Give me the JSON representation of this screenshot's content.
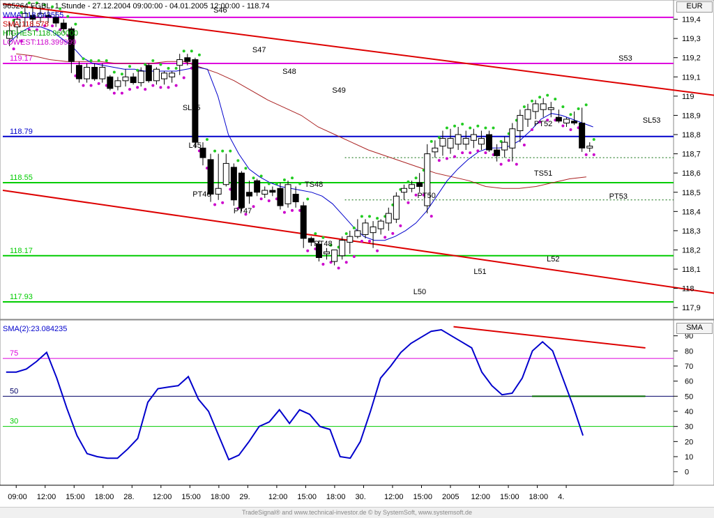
{
  "header": {
    "title": "965264  FGBL, 1 Stunde - 27.12.2004 09:00:00 - 04.01.2005 12:00:00 - 118.74",
    "indicators": [
      {
        "text": "WMA:118.843555",
        "color": "#0000cc"
      },
      {
        "text": "SMA:118.578",
        "color": "#cc0000"
      },
      {
        "text": "HIGHEST:118.960000",
        "color": "#00aa00"
      },
      {
        "text": "LOWEST:118.399999",
        "color": "#cc00cc"
      }
    ],
    "currency": "EUR",
    "lower_label": "SMA(2):23.084235",
    "lower_axis_label": "SMA"
  },
  "footer": "TradeSignal® and www.technical-investor.de © by SystemSoft, www.systemsoft.de",
  "chart_data": [
    {
      "type": "candlestick",
      "ylim": [
        117.85,
        119.5
      ],
      "y_ticks": [
        "119,4",
        "119,3",
        "119,2",
        "119,1",
        "119",
        "118,9",
        "118,8",
        "118,7",
        "118,6",
        "118,5",
        "118,4",
        "118,3",
        "118,2",
        "118,1",
        "118",
        "117,9"
      ],
      "x_tick_labels": [
        "09:00",
        "12:00",
        "15:00",
        "18:00",
        "28.",
        "12:00",
        "15:00",
        "18:00",
        "29.",
        "12:00",
        "15:00",
        "18:00",
        "30.",
        "12:00",
        "15:00",
        "2005",
        "12:00",
        "15:00",
        "18:00",
        "4."
      ],
      "candles": [
        {
          "o": 119.3,
          "h": 119.38,
          "l": 119.26,
          "c": 119.34
        },
        {
          "o": 119.36,
          "h": 119.42,
          "l": 119.3,
          "c": 119.4
        },
        {
          "o": 119.41,
          "h": 119.47,
          "l": 119.36,
          "c": 119.43
        },
        {
          "o": 119.42,
          "h": 119.47,
          "l": 119.36,
          "c": 119.4
        },
        {
          "o": 119.41,
          "h": 119.46,
          "l": 119.38,
          "c": 119.43
        },
        {
          "o": 119.42,
          "h": 119.45,
          "l": 119.38,
          "c": 119.41
        },
        {
          "o": 119.41,
          "h": 119.44,
          "l": 119.36,
          "c": 119.38
        },
        {
          "o": 119.38,
          "h": 119.4,
          "l": 119.33,
          "c": 119.35
        },
        {
          "o": 119.35,
          "h": 119.36,
          "l": 119.12,
          "c": 119.18
        },
        {
          "o": 119.16,
          "h": 119.18,
          "l": 119.07,
          "c": 119.09
        },
        {
          "o": 119.09,
          "h": 119.17,
          "l": 119.07,
          "c": 119.15
        },
        {
          "o": 119.15,
          "h": 119.17,
          "l": 119.08,
          "c": 119.09
        },
        {
          "o": 119.09,
          "h": 119.17,
          "l": 119.07,
          "c": 119.15
        },
        {
          "o": 119.1,
          "h": 119.11,
          "l": 119.03,
          "c": 119.04
        },
        {
          "o": 119.05,
          "h": 119.1,
          "l": 119.03,
          "c": 119.08
        },
        {
          "o": 119.08,
          "h": 119.14,
          "l": 119.05,
          "c": 119.1
        },
        {
          "o": 119.1,
          "h": 119.12,
          "l": 119.06,
          "c": 119.07
        },
        {
          "o": 119.07,
          "h": 119.15,
          "l": 119.05,
          "c": 119.13
        },
        {
          "o": 119.16,
          "h": 119.17,
          "l": 119.07,
          "c": 119.08
        },
        {
          "o": 119.08,
          "h": 119.15,
          "l": 119.06,
          "c": 119.14
        },
        {
          "o": 119.09,
          "h": 119.13,
          "l": 119.06,
          "c": 119.12
        },
        {
          "o": 119.1,
          "h": 119.13,
          "l": 119.07,
          "c": 119.12
        },
        {
          "o": 119.16,
          "h": 119.22,
          "l": 119.11,
          "c": 119.19
        },
        {
          "o": 119.2,
          "h": 119.22,
          "l": 119.16,
          "c": 119.18
        },
        {
          "o": 119.19,
          "h": 119.2,
          "l": 118.73,
          "c": 118.76
        },
        {
          "o": 118.73,
          "h": 118.76,
          "l": 118.64,
          "c": 118.68
        },
        {
          "o": 118.67,
          "h": 118.7,
          "l": 118.45,
          "c": 118.49
        },
        {
          "o": 118.49,
          "h": 118.7,
          "l": 118.46,
          "c": 118.52
        },
        {
          "o": 118.54,
          "h": 118.7,
          "l": 118.53,
          "c": 118.65
        },
        {
          "o": 118.63,
          "h": 118.65,
          "l": 118.43,
          "c": 118.46
        },
        {
          "o": 118.6,
          "h": 118.61,
          "l": 118.4,
          "c": 118.42
        },
        {
          "o": 118.5,
          "h": 118.56,
          "l": 118.44,
          "c": 118.48
        },
        {
          "o": 118.56,
          "h": 118.57,
          "l": 118.48,
          "c": 118.5
        },
        {
          "o": 118.49,
          "h": 118.53,
          "l": 118.47,
          "c": 118.51
        },
        {
          "o": 118.51,
          "h": 118.53,
          "l": 118.48,
          "c": 118.5
        },
        {
          "o": 118.52,
          "h": 118.55,
          "l": 118.41,
          "c": 118.43
        },
        {
          "o": 118.44,
          "h": 118.56,
          "l": 118.42,
          "c": 118.54
        },
        {
          "o": 118.49,
          "h": 118.53,
          "l": 118.42,
          "c": 118.45
        },
        {
          "o": 118.43,
          "h": 118.45,
          "l": 118.21,
          "c": 118.26
        },
        {
          "o": 118.26,
          "h": 118.27,
          "l": 118.22,
          "c": 118.24
        },
        {
          "o": 118.23,
          "h": 118.25,
          "l": 118.14,
          "c": 118.16
        },
        {
          "o": 118.18,
          "h": 118.21,
          "l": 118.15,
          "c": 118.19
        },
        {
          "o": 118.14,
          "h": 118.2,
          "l": 118.12,
          "c": 118.2
        },
        {
          "o": 118.17,
          "h": 118.27,
          "l": 118.15,
          "c": 118.25
        },
        {
          "o": 118.24,
          "h": 118.3,
          "l": 118.18,
          "c": 118.27
        },
        {
          "o": 118.27,
          "h": 118.36,
          "l": 118.26,
          "c": 118.3
        },
        {
          "o": 118.28,
          "h": 118.36,
          "l": 118.26,
          "c": 118.34
        },
        {
          "o": 118.29,
          "h": 118.35,
          "l": 118.21,
          "c": 118.32
        },
        {
          "o": 118.31,
          "h": 118.36,
          "l": 118.28,
          "c": 118.35
        },
        {
          "o": 118.34,
          "h": 118.42,
          "l": 118.3,
          "c": 118.39
        },
        {
          "o": 118.36,
          "h": 118.5,
          "l": 118.34,
          "c": 118.48
        },
        {
          "o": 118.5,
          "h": 118.54,
          "l": 118.46,
          "c": 118.52
        },
        {
          "o": 118.52,
          "h": 118.56,
          "l": 118.5,
          "c": 118.54
        },
        {
          "o": 118.55,
          "h": 118.6,
          "l": 118.5,
          "c": 118.53
        },
        {
          "o": 118.43,
          "h": 118.75,
          "l": 118.39,
          "c": 118.7
        },
        {
          "o": 118.71,
          "h": 118.77,
          "l": 118.68,
          "c": 118.73
        },
        {
          "o": 118.74,
          "h": 118.82,
          "l": 118.69,
          "c": 118.78
        },
        {
          "o": 118.73,
          "h": 118.83,
          "l": 118.7,
          "c": 118.78
        },
        {
          "o": 118.75,
          "h": 118.84,
          "l": 118.72,
          "c": 118.8
        },
        {
          "o": 118.75,
          "h": 118.82,
          "l": 118.72,
          "c": 118.78
        },
        {
          "o": 118.77,
          "h": 118.83,
          "l": 118.73,
          "c": 118.8
        },
        {
          "o": 118.75,
          "h": 118.82,
          "l": 118.72,
          "c": 118.78
        },
        {
          "o": 118.8,
          "h": 118.82,
          "l": 118.71,
          "c": 118.72
        },
        {
          "o": 118.72,
          "h": 118.75,
          "l": 118.66,
          "c": 118.69
        },
        {
          "o": 118.72,
          "h": 118.79,
          "l": 118.68,
          "c": 118.76
        },
        {
          "o": 118.73,
          "h": 118.86,
          "l": 118.66,
          "c": 118.83
        },
        {
          "o": 118.82,
          "h": 118.93,
          "l": 118.76,
          "c": 118.9
        },
        {
          "o": 118.88,
          "h": 118.96,
          "l": 118.84,
          "c": 118.93
        },
        {
          "o": 118.92,
          "h": 118.98,
          "l": 118.88,
          "c": 118.96
        },
        {
          "o": 118.93,
          "h": 118.99,
          "l": 118.89,
          "c": 118.96
        },
        {
          "o": 118.93,
          "h": 118.97,
          "l": 118.89,
          "c": 118.94
        },
        {
          "o": 118.89,
          "h": 118.93,
          "l": 118.86,
          "c": 118.87
        },
        {
          "o": 118.86,
          "h": 118.89,
          "l": 118.84,
          "c": 118.88
        },
        {
          "o": 118.87,
          "h": 118.92,
          "l": 118.85,
          "c": 118.86
        },
        {
          "o": 118.86,
          "h": 118.94,
          "l": 118.71,
          "c": 118.73
        },
        {
          "o": 118.73,
          "h": 118.76,
          "l": 118.71,
          "c": 118.74
        }
      ],
      "wma": [
        119.28,
        119.33,
        119.36,
        119.36,
        119.34,
        119.3,
        119.26,
        119.2,
        119.17,
        119.16,
        119.15,
        119.14,
        119.14,
        119.13,
        119.13,
        119.13,
        119.13,
        119.14,
        119.15,
        119.14,
        119.0,
        118.8,
        118.7,
        118.62,
        118.58,
        118.55,
        118.53,
        118.52,
        118.51,
        118.5,
        118.48,
        118.44,
        118.38,
        118.32,
        118.27,
        118.25,
        118.25,
        118.27,
        118.3,
        118.34,
        118.4,
        118.48,
        118.56,
        118.62,
        118.67,
        118.71,
        118.73,
        118.73,
        118.74,
        118.77,
        118.82,
        118.88,
        118.91,
        118.9,
        118.88,
        118.86,
        118.84
      ],
      "sma": [
        119.22,
        119.21,
        119.19,
        119.18,
        119.18,
        119.18,
        119.17,
        119.17,
        119.17,
        119.18,
        119.18,
        119.15,
        119.12,
        119.08,
        119.03,
        118.98,
        118.94,
        118.9,
        118.84,
        118.8,
        118.76,
        118.72,
        118.69,
        118.66,
        118.63,
        118.6,
        118.58,
        118.56,
        118.53,
        118.52,
        118.52,
        118.53,
        118.55,
        118.57,
        118.58
      ],
      "levels": [
        {
          "name": "upper magenta",
          "value": 119.41,
          "color": "#dd00dd",
          "label": ""
        },
        {
          "name": "119.17",
          "value": 119.17,
          "color": "#dd00dd",
          "label": "119.17"
        },
        {
          "name": "118.79",
          "value": 118.79,
          "color": "#0000cc",
          "label": "118.79"
        },
        {
          "name": "118.55",
          "value": 118.55,
          "color": "#00cc00",
          "label": "118.55"
        },
        {
          "name": "118.17",
          "value": 118.17,
          "color": "#00cc00",
          "label": "118.17"
        },
        {
          "name": "117.93",
          "value": 117.93,
          "color": "#00cc00",
          "label": "117.93"
        }
      ],
      "dotted_levels": [
        118.68,
        118.46
      ],
      "trendlines": [
        {
          "from": {
            "x": 0,
            "y": 119.48
          },
          "to": {
            "x": 107,
            "y": 119.0
          },
          "color": "#dd0000"
        },
        {
          "from": {
            "x": 0,
            "y": 118.51
          },
          "to": {
            "x": 107,
            "y": 117.97
          },
          "color": "#dd0000"
        }
      ],
      "signal_labels": [
        {
          "text": "S46",
          "x": 31.4
        },
        {
          "text": "S47",
          "x": 37.2
        },
        {
          "text": "S48",
          "x": 41.7
        },
        {
          "text": "S49",
          "x": 49.1
        },
        {
          "text": "S53",
          "x": 91.8
        },
        {
          "text": "SL45",
          "x": 26.8
        },
        {
          "text": "L45",
          "x": 27.7
        },
        {
          "text": "PT46",
          "x": 28.3
        },
        {
          "text": "PT47",
          "x": 34.4
        },
        {
          "text": "TS48",
          "x": 45.0
        },
        {
          "text": "PT48",
          "x": 46.4
        },
        {
          "text": "PT50",
          "x": 61.8
        },
        {
          "text": "PT52",
          "x": 79.2
        },
        {
          "text": "TS51",
          "x": 79.2
        },
        {
          "text": "PT53",
          "x": 90.4
        },
        {
          "text": "SL53",
          "x": 95.4
        },
        {
          "text": "L50",
          "x": 61.2
        },
        {
          "text": "L51",
          "x": 70.2
        },
        {
          "text": "L52",
          "x": 81.1
        }
      ]
    },
    {
      "type": "line",
      "name": "SMA(2)",
      "ylim": [
        -8,
        100
      ],
      "y_ticks": [
        "90",
        "80",
        "70",
        "60",
        "50",
        "40",
        "30",
        "20",
        "10",
        "0"
      ],
      "levels": [
        {
          "value": 75,
          "color": "#dd00dd",
          "label": "75"
        },
        {
          "value": 50,
          "color": "#000066",
          "label": "50"
        },
        {
          "value": 30,
          "color": "#00cc00",
          "label": "30"
        }
      ],
      "values": [
        66,
        66,
        68,
        73,
        79,
        62,
        42,
        24,
        12,
        10,
        9,
        9,
        15,
        22,
        46,
        55,
        56,
        57,
        63,
        48,
        40,
        24,
        8,
        11,
        20,
        30,
        33,
        41,
        32,
        41,
        38,
        30,
        28,
        10,
        9,
        20,
        40,
        62,
        70,
        79,
        85,
        89,
        93,
        94,
        90,
        86,
        82,
        66,
        57,
        51,
        52,
        62,
        80,
        86,
        80,
        62,
        44,
        24
      ],
      "trendlines": [
        {
          "from": {
            "x": 67.2,
            "y": 96
          },
          "to": {
            "x": 95.8,
            "y": 82
          },
          "color": "#dd0000"
        },
        {
          "from": {
            "x": 78.9,
            "y": 50
          },
          "to": {
            "x": 95.8,
            "y": 50
          },
          "color": "#006600"
        }
      ]
    }
  ]
}
